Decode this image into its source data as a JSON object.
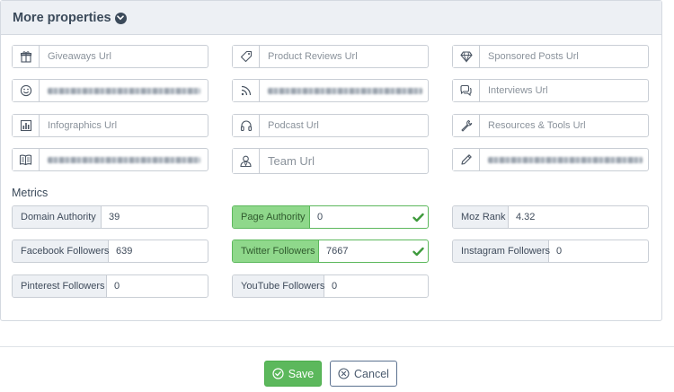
{
  "panel": {
    "title": "More properties"
  },
  "fields": [
    {
      "name": "giveaways-url-input",
      "icon": "gift-icon",
      "placeholder": "Giveaways Url",
      "blurred": false
    },
    {
      "name": "product-reviews-url-input",
      "icon": "tag-icon",
      "placeholder": "Product Reviews Url",
      "blurred": false
    },
    {
      "name": "sponsored-posts-url-input",
      "icon": "diamond-icon",
      "placeholder": "Sponsored Posts Url",
      "blurred": false
    },
    {
      "name": "smile-url-input",
      "icon": "smile-icon",
      "placeholder": "",
      "blurred": true
    },
    {
      "name": "rss-url-input",
      "icon": "rss-icon",
      "placeholder": "",
      "blurred": true
    },
    {
      "name": "interviews-url-input",
      "icon": "comments-icon",
      "placeholder": "Interviews Url",
      "blurred": false
    },
    {
      "name": "infographics-url-input",
      "icon": "bar-chart-icon",
      "placeholder": "Infographics Url",
      "blurred": false
    },
    {
      "name": "podcast-url-input",
      "icon": "headphones-icon",
      "placeholder": "Podcast Url",
      "blurred": false
    },
    {
      "name": "resources-tools-url-input",
      "icon": "wrench-icon",
      "placeholder": "Resources & Tools Url",
      "blurred": false
    },
    {
      "name": "book-url-input",
      "icon": "book-icon",
      "placeholder": "",
      "blurred": true
    },
    {
      "name": "team-url-input",
      "icon": "user-icon",
      "placeholder": "Team Url",
      "blurred": false,
      "big": true
    },
    {
      "name": "pencil-url-input",
      "icon": "pencil-icon",
      "placeholder": "",
      "blurred": true
    }
  ],
  "metrics": {
    "title": "Metrics",
    "items": [
      {
        "name": "domain-authority",
        "label": "Domain Authority",
        "value": "39",
        "verified": false
      },
      {
        "name": "page-authority",
        "label": "Page Authority",
        "value": "0",
        "verified": true
      },
      {
        "name": "moz-rank",
        "label": "Moz Rank",
        "value": "4.32",
        "verified": false
      },
      {
        "name": "facebook-followers",
        "label": "Facebook Followers",
        "value": "639",
        "verified": false
      },
      {
        "name": "twitter-followers",
        "label": "Twitter Followers",
        "value": "7667",
        "verified": true
      },
      {
        "name": "instagram-followers",
        "label": "Instagram Followers",
        "value": "0",
        "verified": false
      },
      {
        "name": "pinterest-followers",
        "label": "Pinterest Followers",
        "value": "0",
        "verified": false
      },
      {
        "name": "youtube-followers",
        "label": "YouTube Followers",
        "value": "0",
        "verified": false
      }
    ]
  },
  "footer": {
    "save_label": "Save",
    "cancel_label": "Cancel"
  },
  "colors": {
    "success": "#5cb85c",
    "verified_label": "#8fd88b",
    "header_bg": "#edf0f4",
    "text": "#3b4a5a"
  }
}
